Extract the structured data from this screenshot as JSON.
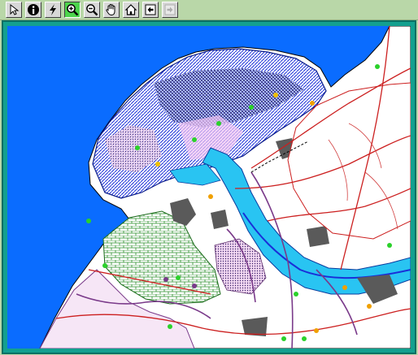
{
  "toolbar": {
    "tools": [
      {
        "id": "select",
        "icon": "arrow-pointer-icon",
        "active": false,
        "enabled": true
      },
      {
        "id": "info",
        "icon": "info-icon",
        "active": false,
        "enabled": true
      },
      {
        "id": "hotlink",
        "icon": "lightning-icon",
        "active": false,
        "enabled": true
      },
      {
        "id": "zoom-in",
        "icon": "zoom-in-icon",
        "active": true,
        "enabled": true
      },
      {
        "id": "zoom-out",
        "icon": "zoom-out-icon",
        "active": false,
        "enabled": true
      },
      {
        "id": "pan",
        "icon": "hand-icon",
        "active": false,
        "enabled": true
      },
      {
        "id": "home",
        "icon": "home-icon",
        "active": false,
        "enabled": true
      },
      {
        "id": "back",
        "icon": "arrow-left-icon",
        "active": false,
        "enabled": true
      },
      {
        "id": "forward",
        "icon": "arrow-right-icon",
        "active": false,
        "enabled": false
      }
    ]
  },
  "map": {
    "colors": {
      "sea": "#0a6cff",
      "land": "#ffffff",
      "river": "#29c4f2",
      "frame": "#13a08f",
      "roads": "#cc1f1f",
      "borders": "#7a3a8a",
      "urban": "#5a5a5a",
      "wetland": "#2b8f2b",
      "delta_hatch": "#1b2fd8"
    }
  }
}
